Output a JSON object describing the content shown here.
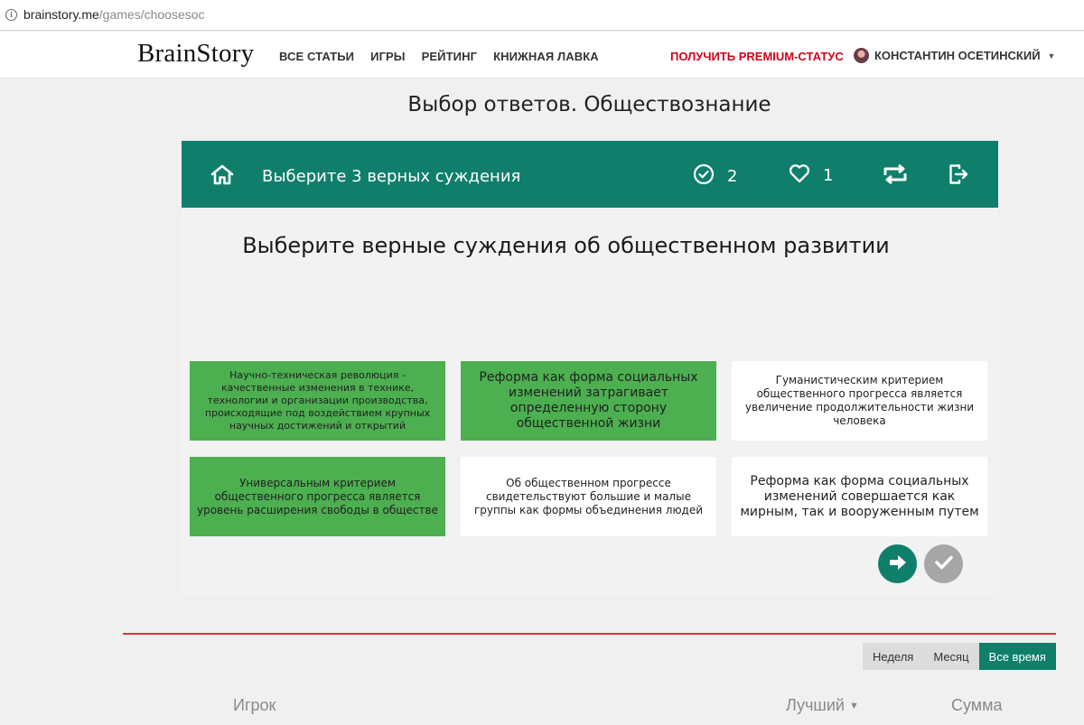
{
  "browser": {
    "url_host": "brainstory.me",
    "url_path": "/games/choosesoc"
  },
  "navbar": {
    "logo": "BrainStory",
    "items": [
      "ВСЕ СТАТЬИ",
      "ИГРЫ",
      "РЕЙТИНГ",
      "КНИЖНАЯ ЛАВКА"
    ],
    "premium": "ПОЛУЧИТЬ PREMIUM-СТАТУС",
    "user_name": "КОНСТАНТИН ОСЕТИНСКИЙ"
  },
  "page": {
    "title": "Выбор ответов. Обществознание"
  },
  "game": {
    "task": "Выберите 3 верных суждения",
    "correct_count": "2",
    "lives_count": "1",
    "question": "Выберите верные суждения об общественном развитии",
    "options": [
      {
        "text": "Научно-техническая революция - качественные изменения в технике, технологии и организации производства, происходящие под воздействием крупных научных достижений и открытий",
        "selected": true
      },
      {
        "text": "Реформа как форма социальных изменений затрагивает определенную сторону общественной жизни",
        "selected": true
      },
      {
        "text": "Гуманистическим критерием общественного прогресса является увеличение продолжительности жизни человека",
        "selected": false
      },
      {
        "text": "Универсальным критерием общественного прогресса является уровень расширения свободы в обществе",
        "selected": true
      },
      {
        "text": "Об общественном прогрессе свидетельствуют большие и малые группы как формы объединения людей",
        "selected": false
      },
      {
        "text": "Реформа как форма социальных изменений совершается как мирным, так и вооруженным путем",
        "selected": false
      }
    ],
    "icons": [
      "home-icon",
      "check-circle-icon",
      "heart-icon",
      "repeat-icon",
      "exit-icon",
      "arrow-right-icon",
      "check-icon"
    ],
    "colors": {
      "header": "#0f7f6c",
      "selected": "#4caf50",
      "disabled": "#a6a6a6"
    }
  },
  "leaderboard": {
    "periods": [
      "Неделя",
      "Месяц",
      "Все время"
    ],
    "active_period": "Все время",
    "columns": {
      "player": "Игрок",
      "best": "Лучший",
      "sum": "Сумма"
    }
  }
}
